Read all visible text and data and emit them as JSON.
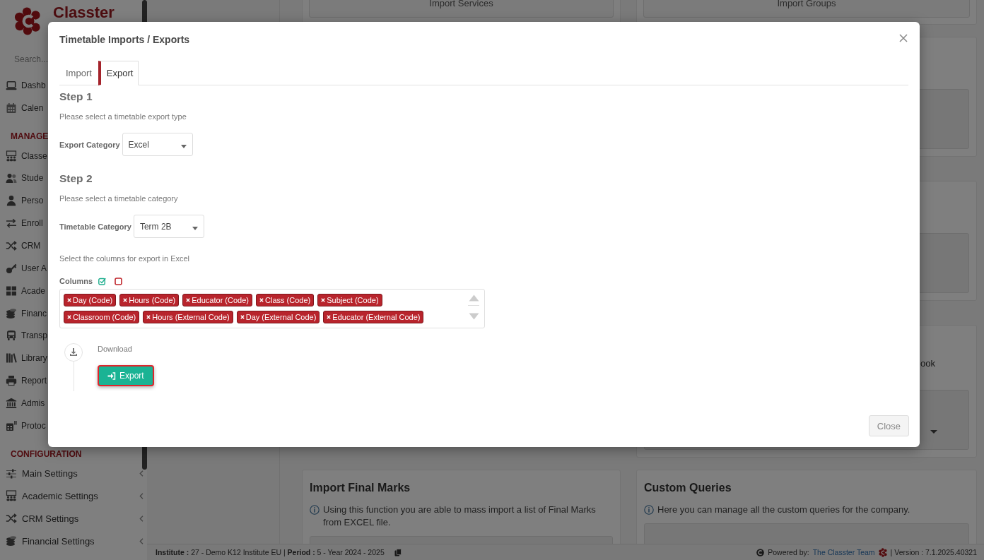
{
  "sidebar": {
    "logo_text": "Classter",
    "search": {
      "placeholder": "Search..."
    },
    "sections": [
      {
        "items": [
          {
            "label": "Dashb"
          },
          {
            "label": "Calen"
          }
        ]
      },
      {
        "title": "MANAGE",
        "items": [
          {
            "label": "Classe"
          },
          {
            "label": "Stude"
          },
          {
            "label": "Perso"
          },
          {
            "label": "Enroll"
          },
          {
            "label": "CRM"
          },
          {
            "label": "User A"
          },
          {
            "label": "Acade"
          },
          {
            "label": "Financ"
          },
          {
            "label": "Transp"
          },
          {
            "label": "Library"
          },
          {
            "label": "Report"
          },
          {
            "label": "Admis"
          },
          {
            "label": "Protoc"
          }
        ]
      },
      {
        "title": "CONFIGURATION",
        "items": [
          {
            "label": "Main Settings",
            "expanded": false
          },
          {
            "label": "Academic Settings",
            "expanded": false
          },
          {
            "label": "CRM Settings",
            "expanded": false
          },
          {
            "label": "Financial Settings",
            "expanded": false
          }
        ]
      }
    ]
  },
  "content": {
    "top_buttons": [
      "Import Services",
      "Import Groups"
    ],
    "right_panels": [
      {
        "kind": "box"
      },
      {
        "kind": "box"
      },
      {
        "kind": "select",
        "text": "ook"
      }
    ],
    "bottom_cards": [
      {
        "title": "Import Final Marks",
        "info": "Using this function you are able to mass import a list of Final Marks from EXCEL file."
      },
      {
        "title": "Custom Queries",
        "info": "Here you can manage all the custom queries for the company."
      }
    ]
  },
  "status_bar": {
    "left": "**Institute :** 27 - Demo K12 Institute EU | **Period :** 5 - Year 2024 - 2025",
    "powered_by": "Powered by:",
    "team_link": "The Classter Team",
    "version": "| Version : 7.1.2025.40321"
  },
  "modal": {
    "title": "Timetable Imports / Exports",
    "tabs": [
      {
        "label": "Import",
        "selected": false
      },
      {
        "label": "Export",
        "selected": true
      }
    ],
    "steps": [
      {
        "heading": "Step 1",
        "hint": "Please select a timetable export type",
        "field": {
          "label": "Export Category",
          "value": "Excel"
        }
      },
      {
        "heading": "Step 2",
        "hint": "Please select a timetable category",
        "field": {
          "label": "Timetable Category",
          "value": "Term 2B"
        }
      }
    ],
    "columns_hint": "Select the columns for export in Excel",
    "columns": {
      "label": "Columns",
      "tags": [
        "Day (Code)",
        "Hours (Code)",
        "Educator (Code)",
        "Class (Code)",
        "Subject (Code)",
        "Classroom (Code)",
        "Hours (External Code)",
        "Day (External Code)",
        "Educator (External Code)"
      ]
    },
    "download": {
      "label": "Download",
      "button": "Export"
    },
    "footer_button": "Close"
  }
}
